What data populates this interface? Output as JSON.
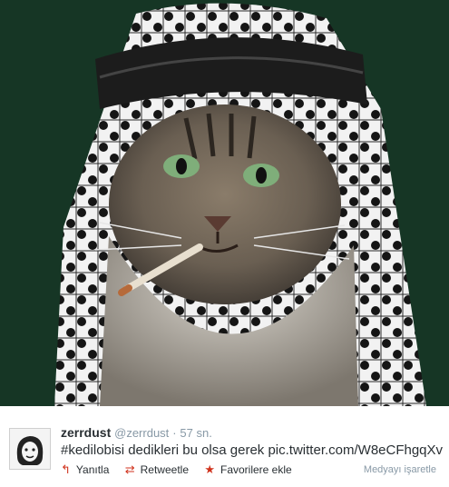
{
  "media": {
    "alt_icon": "cat-in-keffiyeh-photo"
  },
  "tweet": {
    "user": {
      "name": "zerrdust",
      "handle": "@zerrdust",
      "avatar_icon": "avatar-face"
    },
    "separator": "·",
    "time": "57 sn.",
    "text": "#kedilobisi dedikleri bu olsa gerek pic.twitter.com/W8eCFhgqXv",
    "actions": [
      {
        "label": "Yanıtla",
        "icon": "reply-icon",
        "glyph": "↰"
      },
      {
        "label": "Retweetle",
        "icon": "retweet-icon",
        "glyph": "⇄"
      },
      {
        "label": "Favorilere ekle",
        "icon": "star-icon",
        "glyph": "★"
      }
    ],
    "media_flag": "Medyayı işaretle"
  },
  "colors": {
    "accent_red": "#d0321c",
    "muted_text": "#8899a6",
    "body_text": "#292f33"
  }
}
